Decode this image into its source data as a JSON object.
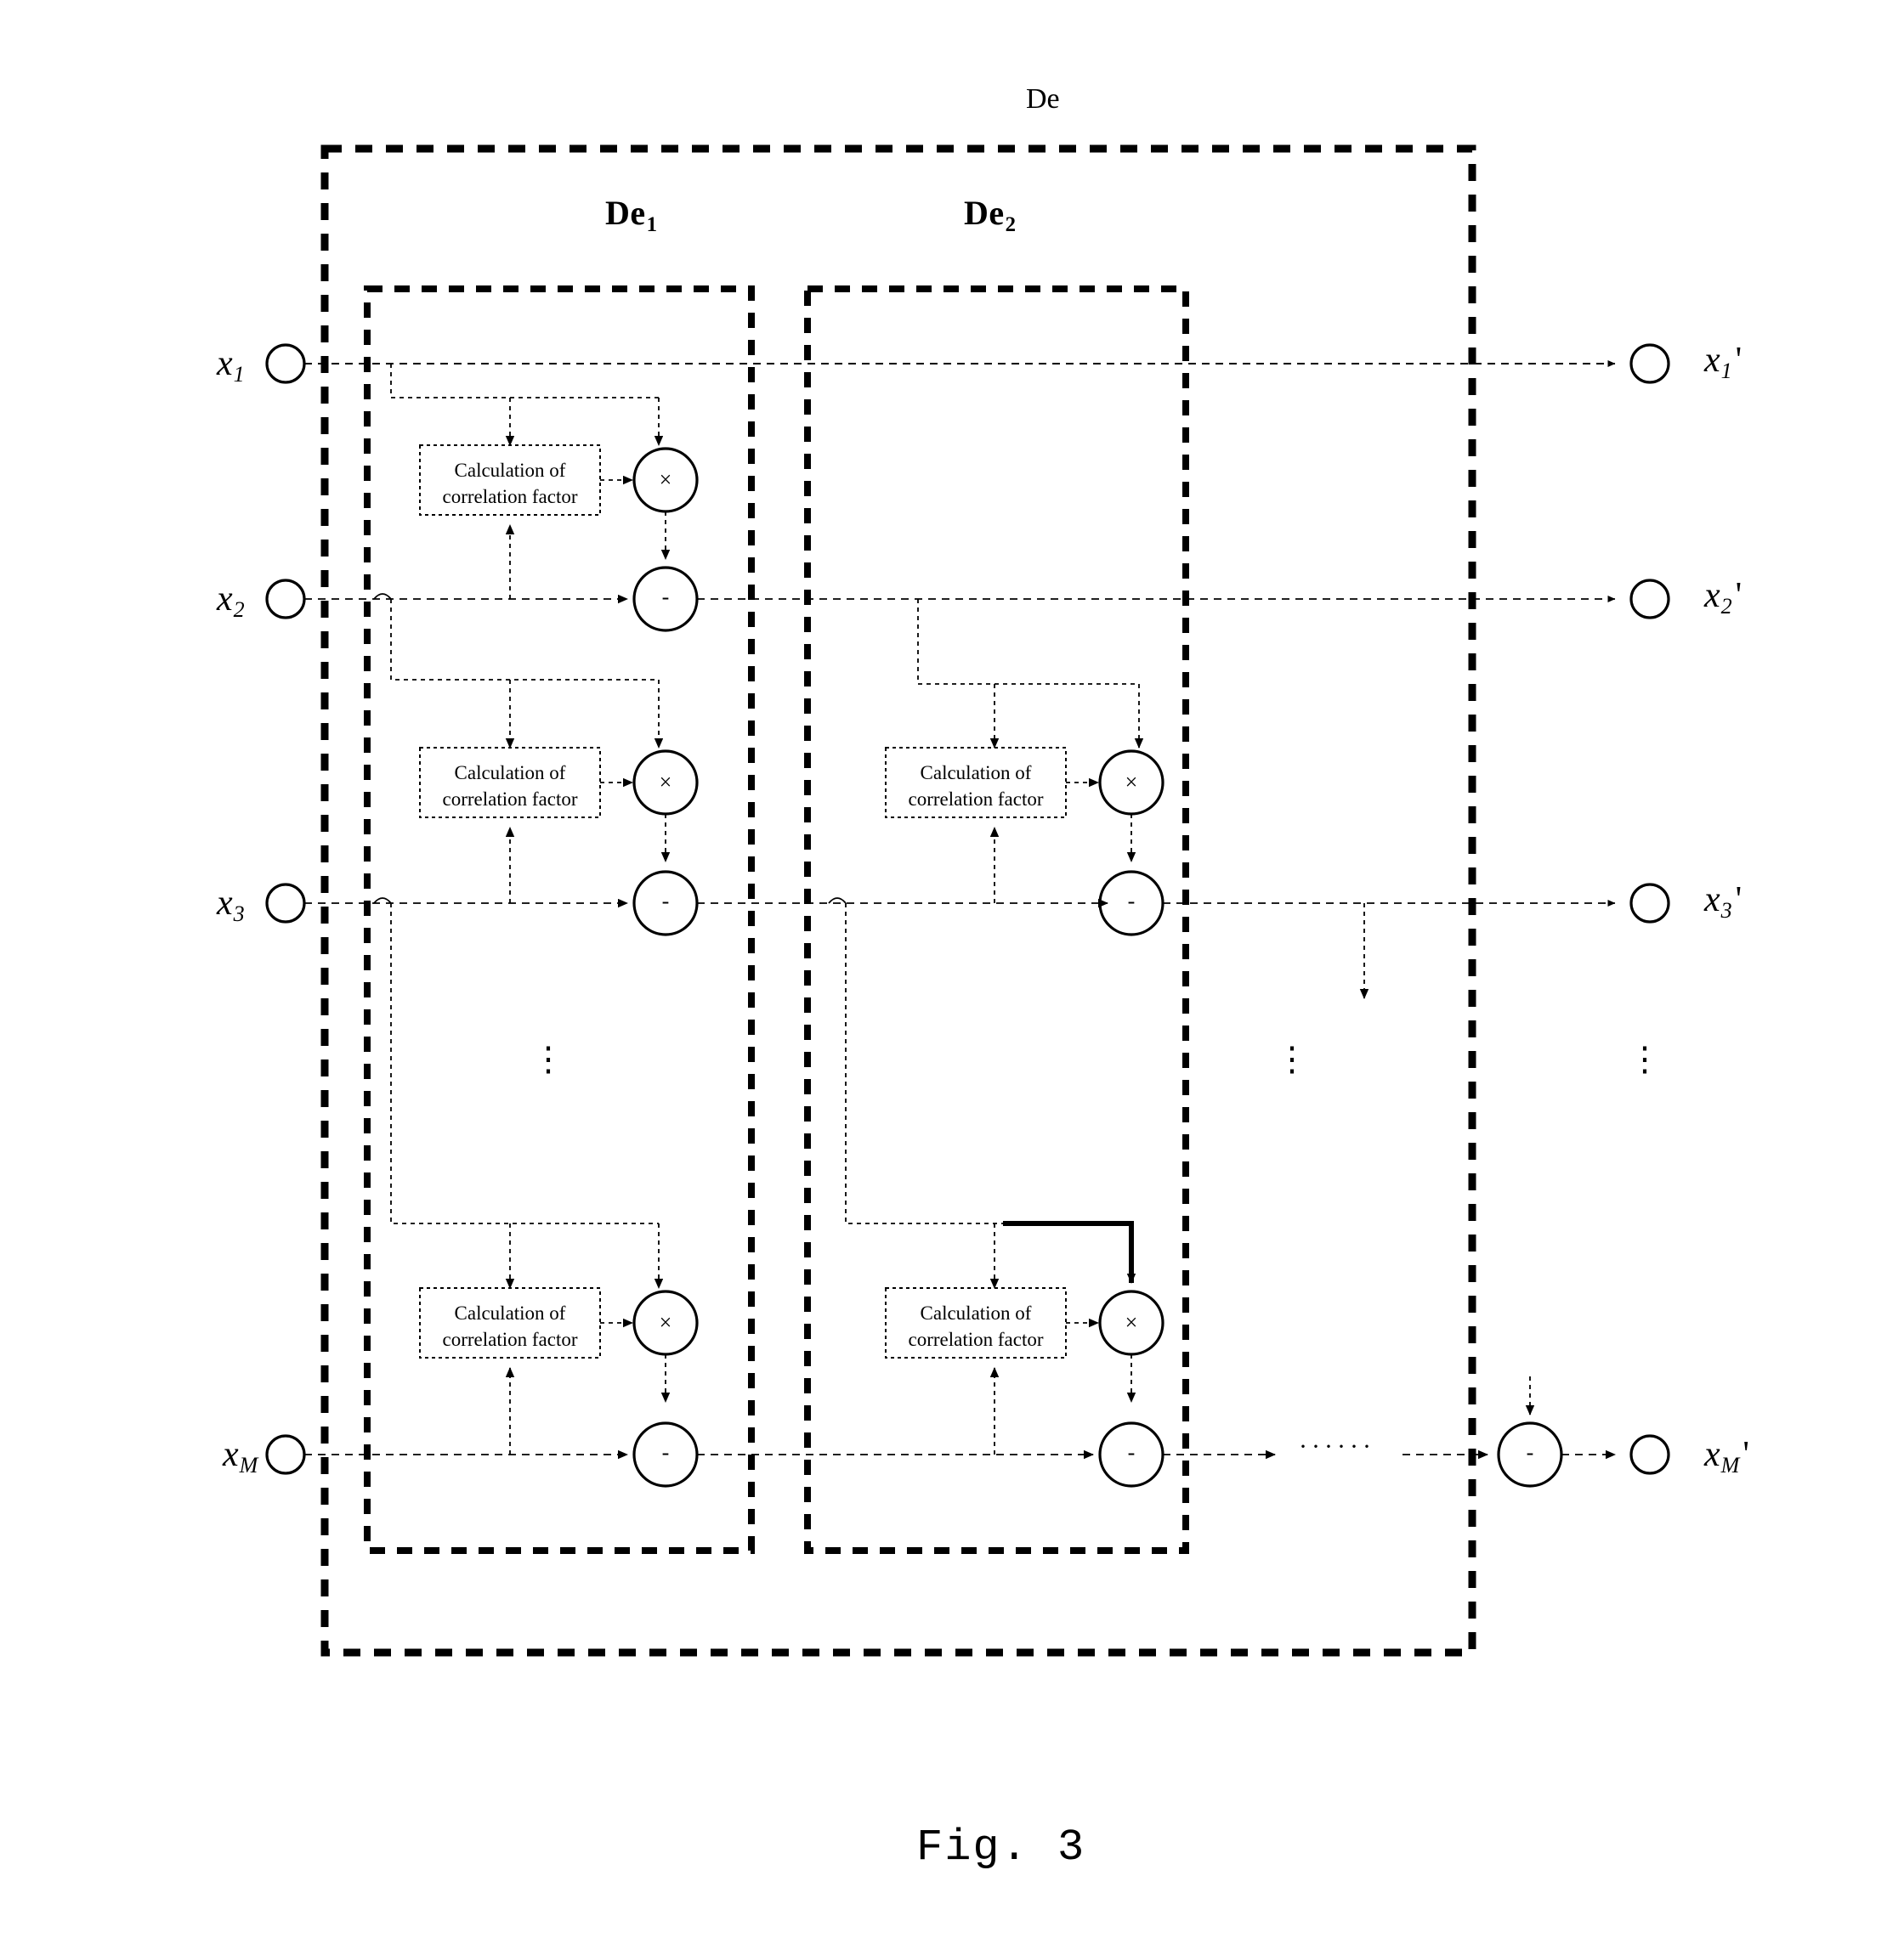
{
  "figure": {
    "caption": "Fig. 3",
    "outer_block_label": "De",
    "stages": [
      {
        "name": "De",
        "subscript": "1"
      },
      {
        "name": "De",
        "subscript": "2"
      }
    ],
    "process_box_text": {
      "line1": "Calculation of",
      "line2": "correlation factor"
    },
    "operators": {
      "multiply": "×",
      "subtract": "-"
    },
    "inputs": [
      {
        "base": "x",
        "subscript": "1"
      },
      {
        "base": "x",
        "subscript": "2"
      },
      {
        "base": "x",
        "subscript": "3"
      },
      {
        "base": "x",
        "subscript": "M"
      }
    ],
    "outputs": [
      {
        "base": "x",
        "subscript": "1",
        "prime": "'"
      },
      {
        "base": "x",
        "subscript": "2",
        "prime": "'"
      },
      {
        "base": "x",
        "subscript": "3",
        "prime": "'"
      },
      {
        "base": "x",
        "subscript": "M",
        "prime": "'"
      }
    ],
    "ellipsis": {
      "vertical": "⋮",
      "horizontal": "······"
    },
    "colors": {
      "stroke": "#000000",
      "background": "#ffffff"
    }
  }
}
